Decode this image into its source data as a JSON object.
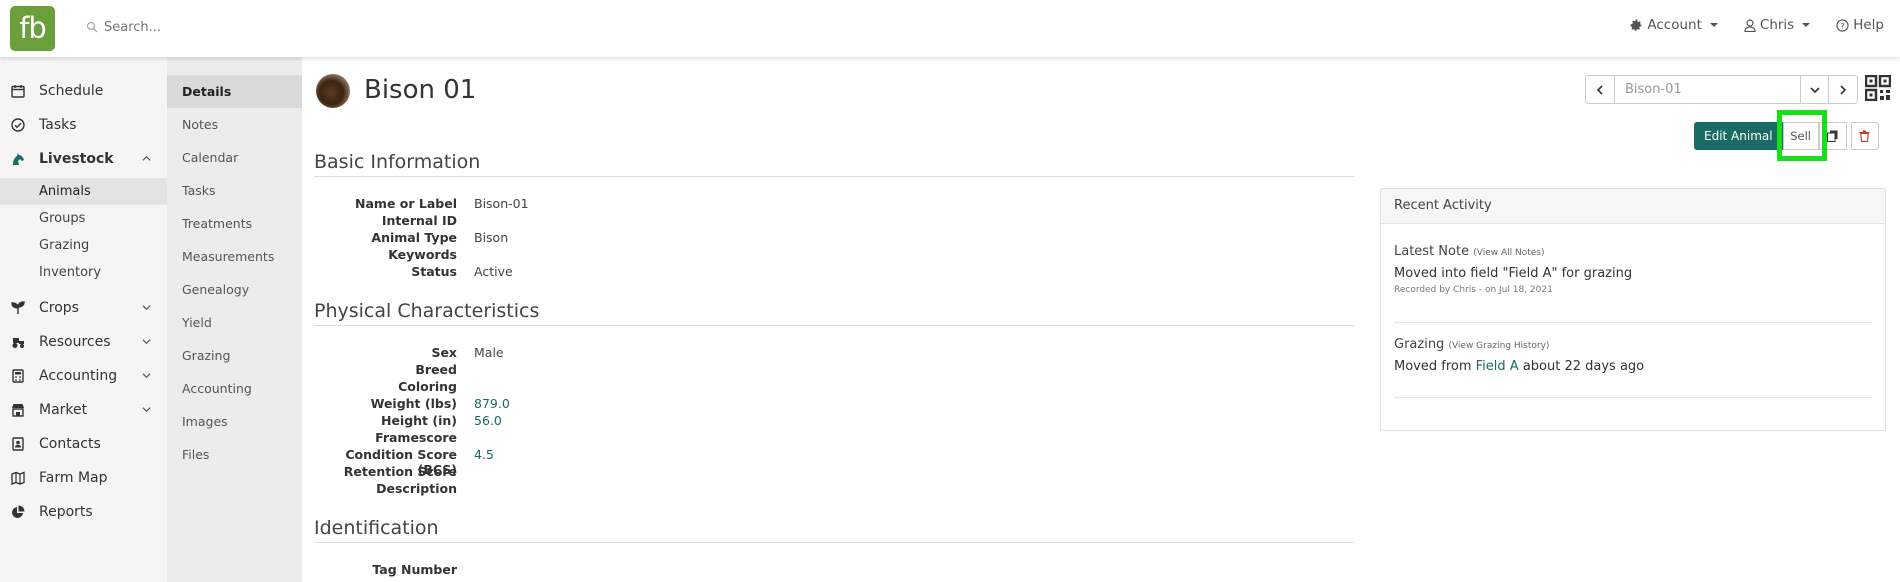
{
  "app": {
    "logo_text": "fb",
    "brand_color": "#6a9f3c",
    "accent_color": "#1a6b64"
  },
  "search": {
    "placeholder": "Search..."
  },
  "topnav": {
    "account": "Account",
    "user": "Chris",
    "help": "Help"
  },
  "sidebar": {
    "schedule": "Schedule",
    "tasks": "Tasks",
    "livestock": "Livestock",
    "livestock_sub": [
      "Animals",
      "Groups",
      "Grazing",
      "Inventory"
    ],
    "crops": "Crops",
    "resources": "Resources",
    "accounting": "Accounting",
    "market": "Market",
    "contacts": "Contacts",
    "farm_map": "Farm Map",
    "reports": "Reports"
  },
  "subnav": [
    "Details",
    "Notes",
    "Calendar",
    "Tasks",
    "Treatments",
    "Measurements",
    "Genealogy",
    "Yield",
    "Grazing",
    "Accounting",
    "Images",
    "Files"
  ],
  "page": {
    "title": "Bison 01",
    "record_selector": "Bison-01"
  },
  "actions": {
    "edit": "Edit Animal",
    "sell": "Sell"
  },
  "basic": {
    "heading": "Basic Information",
    "rows": [
      {
        "k": "Name or Label",
        "v": "Bison-01"
      },
      {
        "k": "Internal ID",
        "v": ""
      },
      {
        "k": "Animal Type",
        "v": "Bison"
      },
      {
        "k": "Keywords",
        "v": ""
      },
      {
        "k": "Status",
        "v": "Active"
      }
    ]
  },
  "physical": {
    "heading": "Physical Characteristics",
    "rows": [
      {
        "k": "Sex",
        "v": "Male"
      },
      {
        "k": "Breed",
        "v": ""
      },
      {
        "k": "Coloring",
        "v": ""
      },
      {
        "k": "Weight (lbs)",
        "v": "879.0"
      },
      {
        "k": "Height (in)",
        "v": "56.0"
      },
      {
        "k": "Framescore",
        "v": ""
      },
      {
        "k": "Condition Score (BCS)",
        "v": "4.5"
      },
      {
        "k": "Retention Score",
        "v": ""
      },
      {
        "k": "Description",
        "v": ""
      }
    ]
  },
  "identification": {
    "heading": "Identification",
    "rows": [
      {
        "k": "Tag Number",
        "v": ""
      }
    ]
  },
  "activity": {
    "heading": "Recent Activity",
    "note_heading": "Latest Note",
    "note_link": "(View All Notes)",
    "note_text": "Moved into field \"Field A\" for grazing",
    "note_meta": "Recorded by Chris - on Jul 18, 2021",
    "grazing_heading": "Grazing",
    "grazing_link": "(View Grazing History)",
    "grazing_prefix": "Moved from",
    "grazing_field": "Field A",
    "grazing_suffix": "about 22 days ago"
  }
}
